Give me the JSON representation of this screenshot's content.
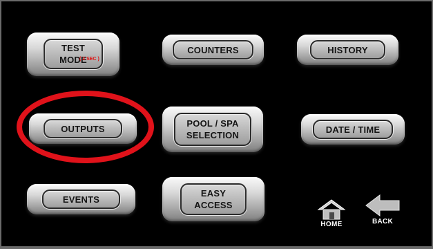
{
  "buttons": {
    "test_mode": {
      "label": "TEST\nMODE",
      "note": "( 2 SEC )"
    },
    "counters": {
      "label": "COUNTERS"
    },
    "history": {
      "label": "HISTORY"
    },
    "outputs": {
      "label": "OUTPUTS"
    },
    "pool_spa_selection": {
      "label": "POOL / SPA\nSELECTION"
    },
    "date_time": {
      "label": "DATE  / TIME"
    },
    "events": {
      "label": "EVENTS"
    },
    "easy_access": {
      "label": "EASY\nACCESS"
    }
  },
  "nav": {
    "home_label": "HOME",
    "back_label": "BACK"
  },
  "colors": {
    "screen_background": "#000000",
    "highlight_ring": "#e0121a",
    "note_text": "#e01010"
  },
  "icons": {
    "home": "home-icon",
    "back": "back-arrow-icon"
  }
}
